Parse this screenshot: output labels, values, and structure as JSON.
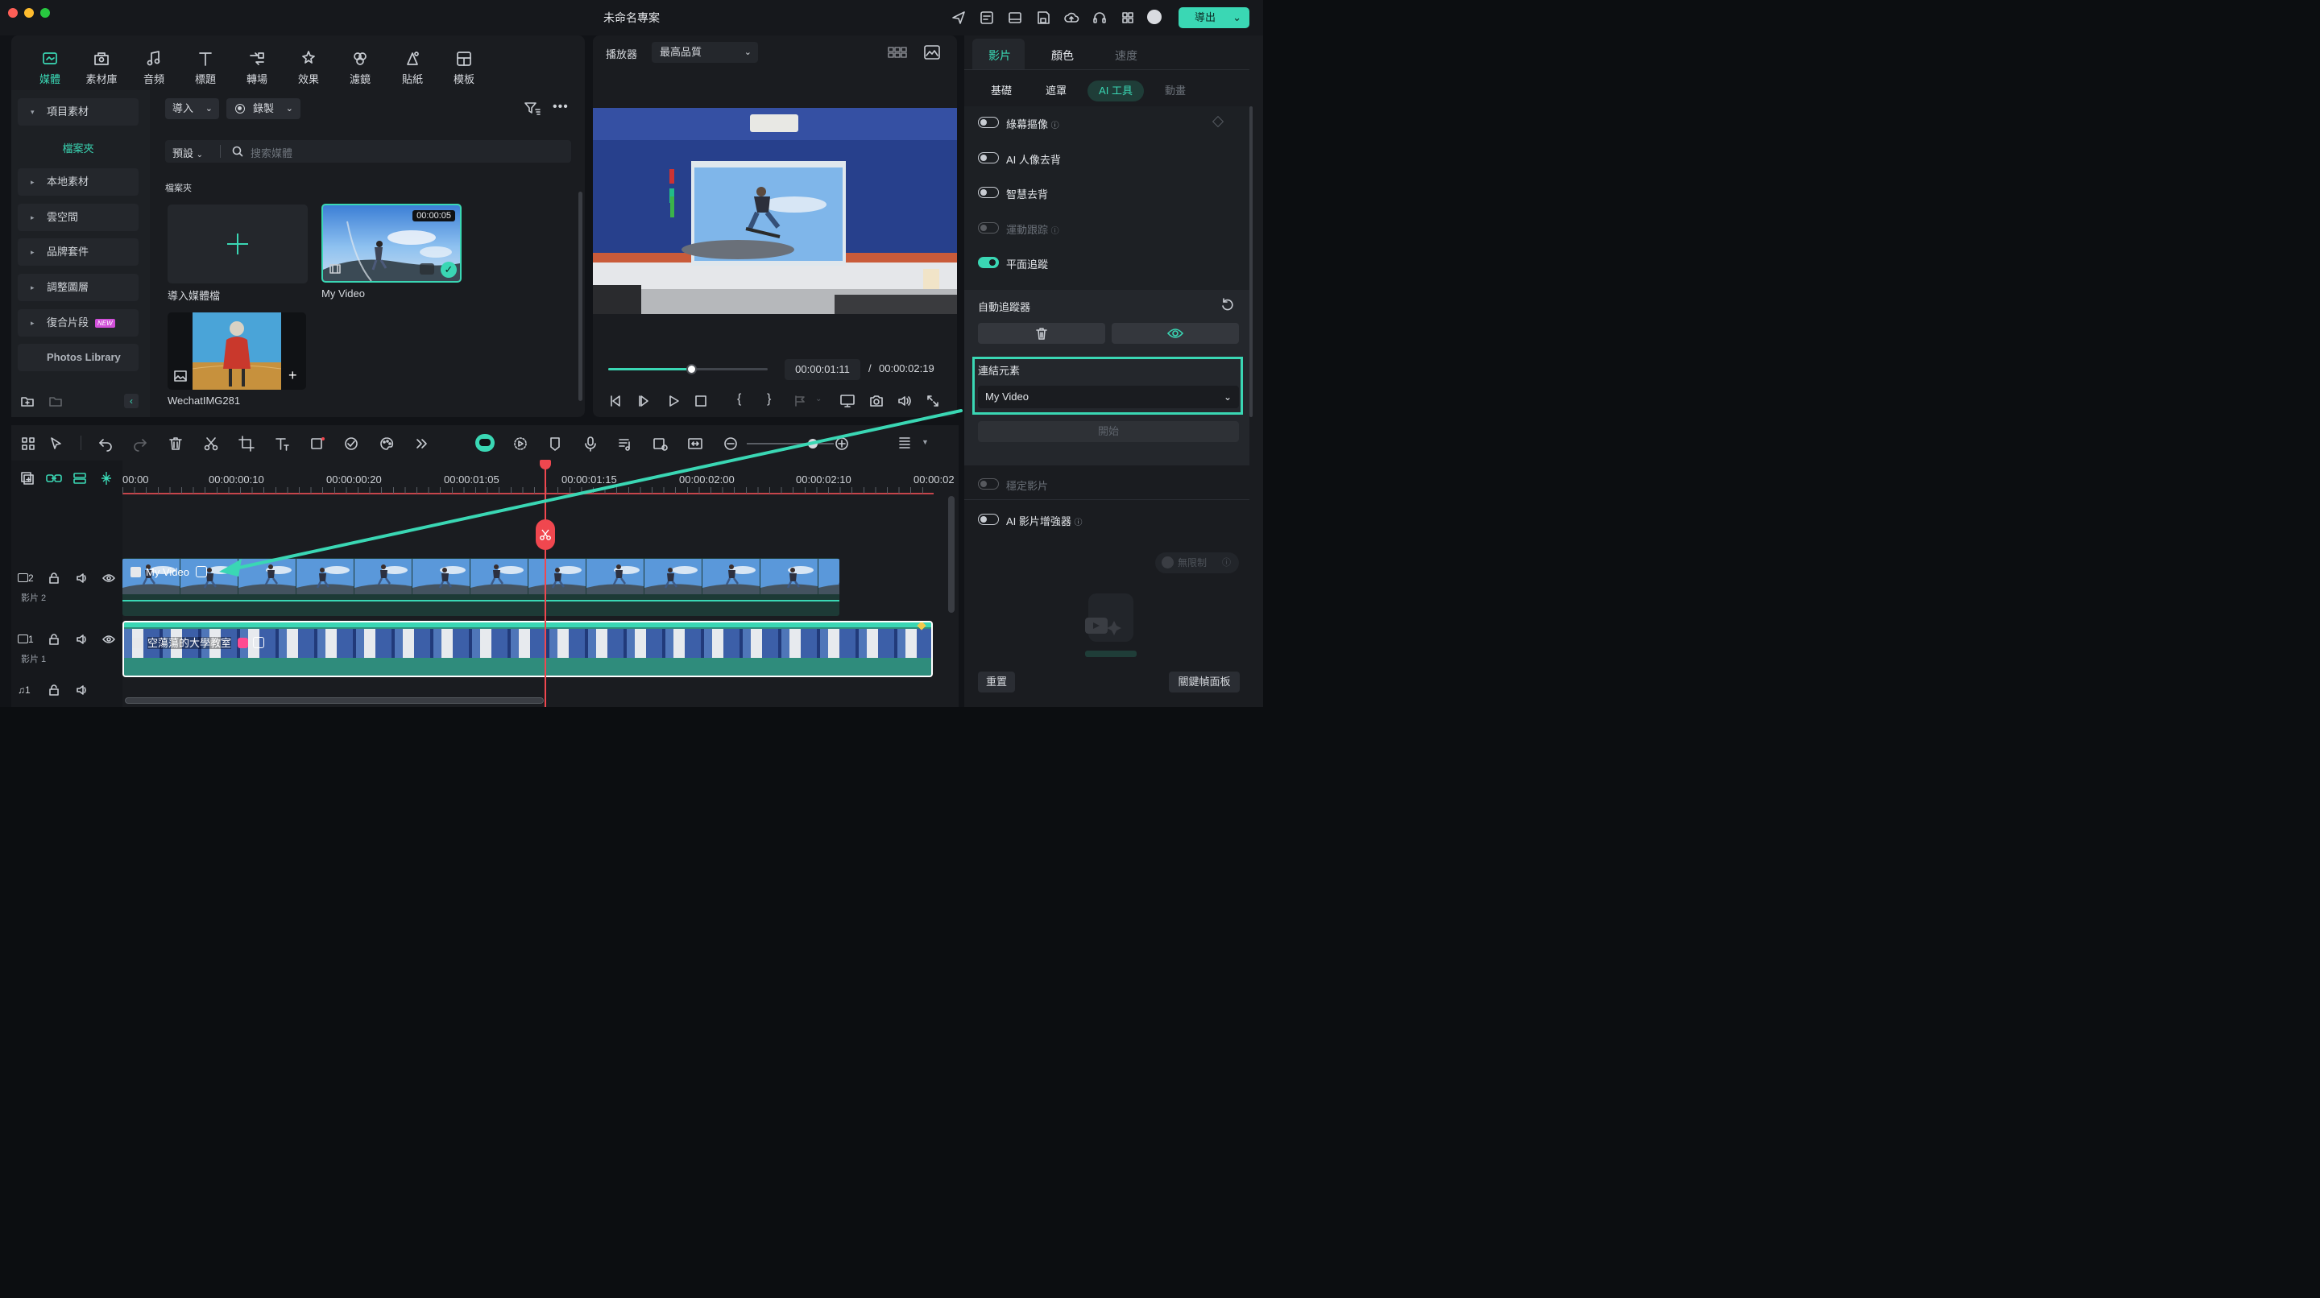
{
  "window": {
    "title": "未命名專案",
    "export_label": "導出"
  },
  "toolbar": {
    "items": [
      {
        "label": "媒體",
        "icon": "media-icon",
        "active": true
      },
      {
        "label": "素材庫",
        "icon": "stock-icon"
      },
      {
        "label": "音頻",
        "icon": "music-icon"
      },
      {
        "label": "標題",
        "icon": "text-icon"
      },
      {
        "label": "轉場",
        "icon": "transition-icon"
      },
      {
        "label": "效果",
        "icon": "effects-icon"
      },
      {
        "label": "濾鏡",
        "icon": "filters-icon"
      },
      {
        "label": "貼紙",
        "icon": "stickers-icon"
      },
      {
        "label": "模板",
        "icon": "templates-icon"
      }
    ]
  },
  "sidebar": {
    "project_media": "項目素材",
    "folder": "檔案夾",
    "items": [
      "本地素材",
      "雲空間",
      "品牌套件",
      "調整圖層",
      "復合片段"
    ],
    "new_badge": "NEW",
    "photos_library": "Photos Library"
  },
  "media": {
    "import_label": "導入",
    "record_label": "錄製",
    "sort_label": "預設",
    "search_placeholder": "搜索媒體",
    "folder_heading": "檔案夾",
    "import_card_label": "導入媒體檔",
    "clip_name": "My Video",
    "clip_duration": "00:00:05",
    "image_name": "WechatIMG281"
  },
  "player": {
    "label": "播放器",
    "quality": "最高品質",
    "current_time": "00:00:01:11",
    "separator": "/",
    "total_time": "00:00:02:19",
    "progress": 0.52
  },
  "properties": {
    "tabs": [
      "影片",
      "顏色",
      "速度"
    ],
    "subtabs": [
      "基礎",
      "遮罩",
      "AI 工具",
      "動畫"
    ],
    "toggles": [
      {
        "label": "綠幕摳像",
        "on": false,
        "disabled": false
      },
      {
        "label": "AI 人像去背",
        "on": false,
        "disabled": false
      },
      {
        "label": "智慧去背",
        "on": false,
        "disabled": false
      },
      {
        "label": "運動跟踪",
        "on": false,
        "disabled": true
      },
      {
        "label": "平面追蹤",
        "on": true,
        "disabled": false
      }
    ],
    "auto_tracker": "自動追蹤器",
    "link_element_label": "連結元素",
    "link_element_value": "My Video",
    "start_label": "開始",
    "stabilize_label": "穩定影片",
    "enhancer_label": "AI 影片增強器",
    "unlimited_label": "無限制",
    "reset_label": "重置",
    "keyframe_label": "關鍵幀面板",
    "accent_color": "#3ad7b4"
  },
  "timeline": {
    "ruler_labels": [
      "00:00",
      "00:00:00:10",
      "00:00:00:20",
      "00:00:01:05",
      "00:00:01:15",
      "00:00:02:00",
      "00:00:02:10",
      "00:00:02"
    ],
    "track2_label": "影片 2",
    "track1_label": "影片 1",
    "track2_num": "2",
    "track1_num": "1",
    "audio_num": "1",
    "clip2_name": "My Video",
    "clip1_name": "空蕩蕩的大學教室",
    "playhead_color": "#f0474f"
  }
}
